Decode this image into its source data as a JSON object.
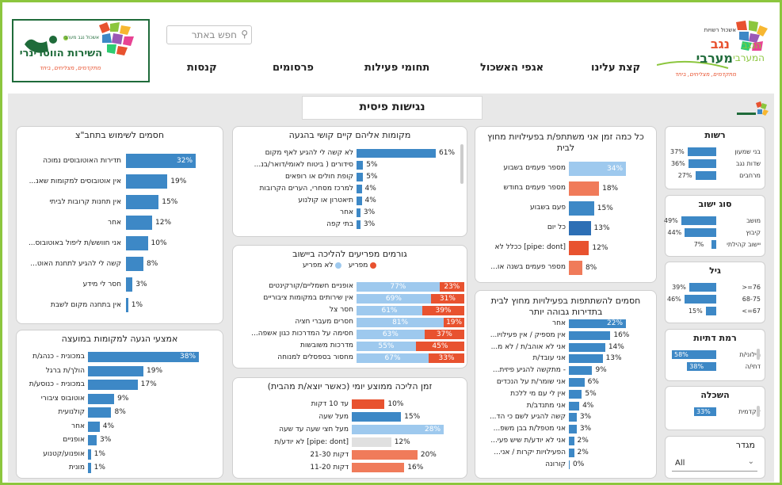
{
  "header": {
    "search_placeholder": "חפש באתר",
    "nav": [
      "קצת עלינו",
      "אגפי האשכול",
      "תחומי פעילות",
      "פרסומים",
      "קנסות"
    ],
    "logo_left": {
      "line1": "אשכול נגב מערבי",
      "line2": "השירות הווטרינרי",
      "tagline": "מתקדמים, מצליחים, ביחד"
    },
    "logo_right": {
      "line1": "אשכול רשויות",
      "line2": "נגב",
      "line3": "מערבי",
      "line4": "הנגב",
      "line5": "המערבי",
      "tagline": "מתקדמים, מצליחים, ביחד"
    }
  },
  "page_title": "נגישות פיסית",
  "colors": {
    "blue": "#3d88c6",
    "lightblue": "#9ec9ee",
    "salmon": "#f07b5a",
    "orange": "#e8522f",
    "darkblue": "#2d6fb5",
    "grey": "#e0e0e0"
  },
  "cards": {
    "transit": {
      "title": "חסמים לשימוש בתחב\"צ",
      "rows": [
        {
          "label": "תדירות האוטובוסים נמוכה",
          "value": "32%"
        },
        {
          "label": "אין אוטובוסים למקומות שאנ...",
          "value": "19%"
        },
        {
          "label": "אין תחנות קרובות לביתי",
          "value": "15%"
        },
        {
          "label": "אחר",
          "value": "12%"
        },
        {
          "label": "אני חוושש/ת ליפול באוטובוס...",
          "value": "10%"
        },
        {
          "label": "קשה לי להגיע לתחנת האוט...",
          "value": "8%"
        },
        {
          "label": "חסר לי מידע",
          "value": "3%"
        },
        {
          "label": "אין בתחנה מקום לשבת",
          "value": "1%"
        }
      ]
    },
    "arrival": {
      "title": "אמצעי הגעה למקומות במועצה",
      "rows": [
        {
          "label": "במכונית - כנהג/ת",
          "value": "38%"
        },
        {
          "label": "הולך/ת ברגל",
          "value": "19%"
        },
        {
          "label": "במכונית - כנוסע/ת",
          "value": "17%"
        },
        {
          "label": "אוטובוס ציבורי",
          "value": "9%"
        },
        {
          "label": "קולנועית",
          "value": "8%"
        },
        {
          "label": "אחר",
          "value": "4%"
        },
        {
          "label": "אופניים",
          "value": "3%"
        },
        {
          "label": "אופנוע/קטנוע",
          "value": "1%"
        },
        {
          "label": "מונית",
          "value": "1%"
        }
      ]
    },
    "places": {
      "title": "מקומות אליהם קיים קושי בהגעה",
      "rows": [
        {
          "label": "לא קשה לי להגיע לאף מקום",
          "value": "61%"
        },
        {
          "label": "סידורים ( ביטוח לאומי/דואר/בנ...",
          "value": "5%"
        },
        {
          "label": "קופת חולים או רופאים",
          "value": "5%"
        },
        {
          "label": "למרכז מסחרי, הערים הקרובות",
          "value": "4%"
        },
        {
          "label": "תיאטרון או קולנוע",
          "value": "4%"
        },
        {
          "label": "אחר",
          "value": "3%"
        },
        {
          "label": "בתי קפה",
          "value": "3%"
        }
      ]
    },
    "walking": {
      "title": "גורמים מפריעים להליכה ביישוב",
      "legend_disturbs": "מפריע",
      "legend_not": "לא מפריע",
      "rows": [
        {
          "label": "אופניים חשמליים/קורקינטים",
          "not": "77%",
          "yes": "23%"
        },
        {
          "label": "אין שירותים במקומות ציבוריים",
          "not": "69%",
          "yes": "31%"
        },
        {
          "label": "חסר צל",
          "not": "61%",
          "yes": "39%"
        },
        {
          "label": "חסרים מעברי חציה",
          "not": "81%",
          "yes": "19%"
        },
        {
          "label": "חסימה על המדרכות כגון אשפה...",
          "not": "63%",
          "yes": "37%"
        },
        {
          "label": "מדרכות משובשות",
          "not": "55%",
          "yes": "45%"
        },
        {
          "label": "מחסור בספסלים למנוחה",
          "not": "67%",
          "yes": "33%"
        }
      ]
    },
    "walktime": {
      "title": "זמן הליכה ממוצע יומי (כאשר יוצא/ת מהבית)",
      "rows": [
        {
          "label": "עד 10 דקות",
          "value": "10%"
        },
        {
          "label": "מעל שעה",
          "value": "15%"
        },
        {
          "label": "מעל חצי שעה עד שעה",
          "value": "28%"
        },
        {
          "label": "[pipe: dont] לא יודע/ת",
          "value": "12%"
        },
        {
          "label": "דקות 21-30",
          "value": "20%"
        },
        {
          "label": "דקות 11-20",
          "value": "16%"
        }
      ]
    },
    "frequency": {
      "title": "כל כמה זמן אני משתתפ/ת בפעילויות מחוץ לבית",
      "rows": [
        {
          "label": "מספר פעמים בשבוע",
          "value": "34%"
        },
        {
          "label": "מספר פעמים בחודש",
          "value": "18%"
        },
        {
          "label": "פעם בשבוע",
          "value": "15%"
        },
        {
          "label": "כל יום",
          "value": "13%"
        },
        {
          "label": "[pipe: dont] ככלל לא",
          "value": "12%"
        },
        {
          "label": "מספר פעמים בשנה או...",
          "value": "8%"
        }
      ]
    },
    "barriers": {
      "title": "חסמים להשתתפות בפעילויות מחוץ לבית בתדירות גבוהה יותר",
      "rows": [
        {
          "label": "אחר",
          "value": "22%"
        },
        {
          "label": "אין מספיק / אין פעילויו...",
          "value": "16%"
        },
        {
          "label": "אני לא אוהב/ת / לא מ...",
          "value": "14%"
        },
        {
          "label": "אני עובד/ת",
          "value": "13%"
        },
        {
          "label": "- מתקשה להגיע פיזית...",
          "value": "9%"
        },
        {
          "label": "אני שומר/ת על הנכדים",
          "value": "6%"
        },
        {
          "label": "אין לי עם מי ללכת",
          "value": "5%"
        },
        {
          "label": "אני מתנדב/ת",
          "value": "4%"
        },
        {
          "label": "קשה להגיע לשם כי הד...",
          "value": "3%"
        },
        {
          "label": "אני מטפל/ת בבן משפ...",
          "value": "3%"
        },
        {
          "label": "אני לא יודע/ת שיש פעי...",
          "value": "2%"
        },
        {
          "label": "הפעילויות יקרות / אני...",
          "value": "2%"
        },
        {
          "label": "קורונה",
          "value": "0%"
        }
      ]
    }
  },
  "filters": {
    "authority": {
      "title": "רשות",
      "rows": [
        {
          "label": "בני שמעון",
          "value": "37%"
        },
        {
          "label": "שדות נגב",
          "value": "36%"
        },
        {
          "label": "מרחבים",
          "value": "27%"
        }
      ]
    },
    "settlement": {
      "title": "סוג ישוב",
      "rows": [
        {
          "label": "מושב",
          "value": "49%"
        },
        {
          "label": "קיבוץ",
          "value": "44%"
        },
        {
          "label": "יישוב קהילתי",
          "value": "7%"
        }
      ]
    },
    "age": {
      "title": "גיל",
      "rows": [
        {
          "label": "76=<",
          "value": "39%"
        },
        {
          "label": "68-75",
          "value": "46%"
        },
        {
          "label": "67=>",
          "value": "15%"
        }
      ]
    },
    "religion": {
      "title": "רמת דתיות",
      "rows": [
        {
          "label": "חילוני/ת",
          "value": "58%"
        },
        {
          "label": "דתי/ה",
          "value": "38%"
        }
      ]
    },
    "education": {
      "title": "השכלה",
      "rows": [
        {
          "label": "אקדמית",
          "value": "33%"
        }
      ]
    },
    "gender": {
      "title": "מגדר",
      "selected": "All"
    }
  }
}
